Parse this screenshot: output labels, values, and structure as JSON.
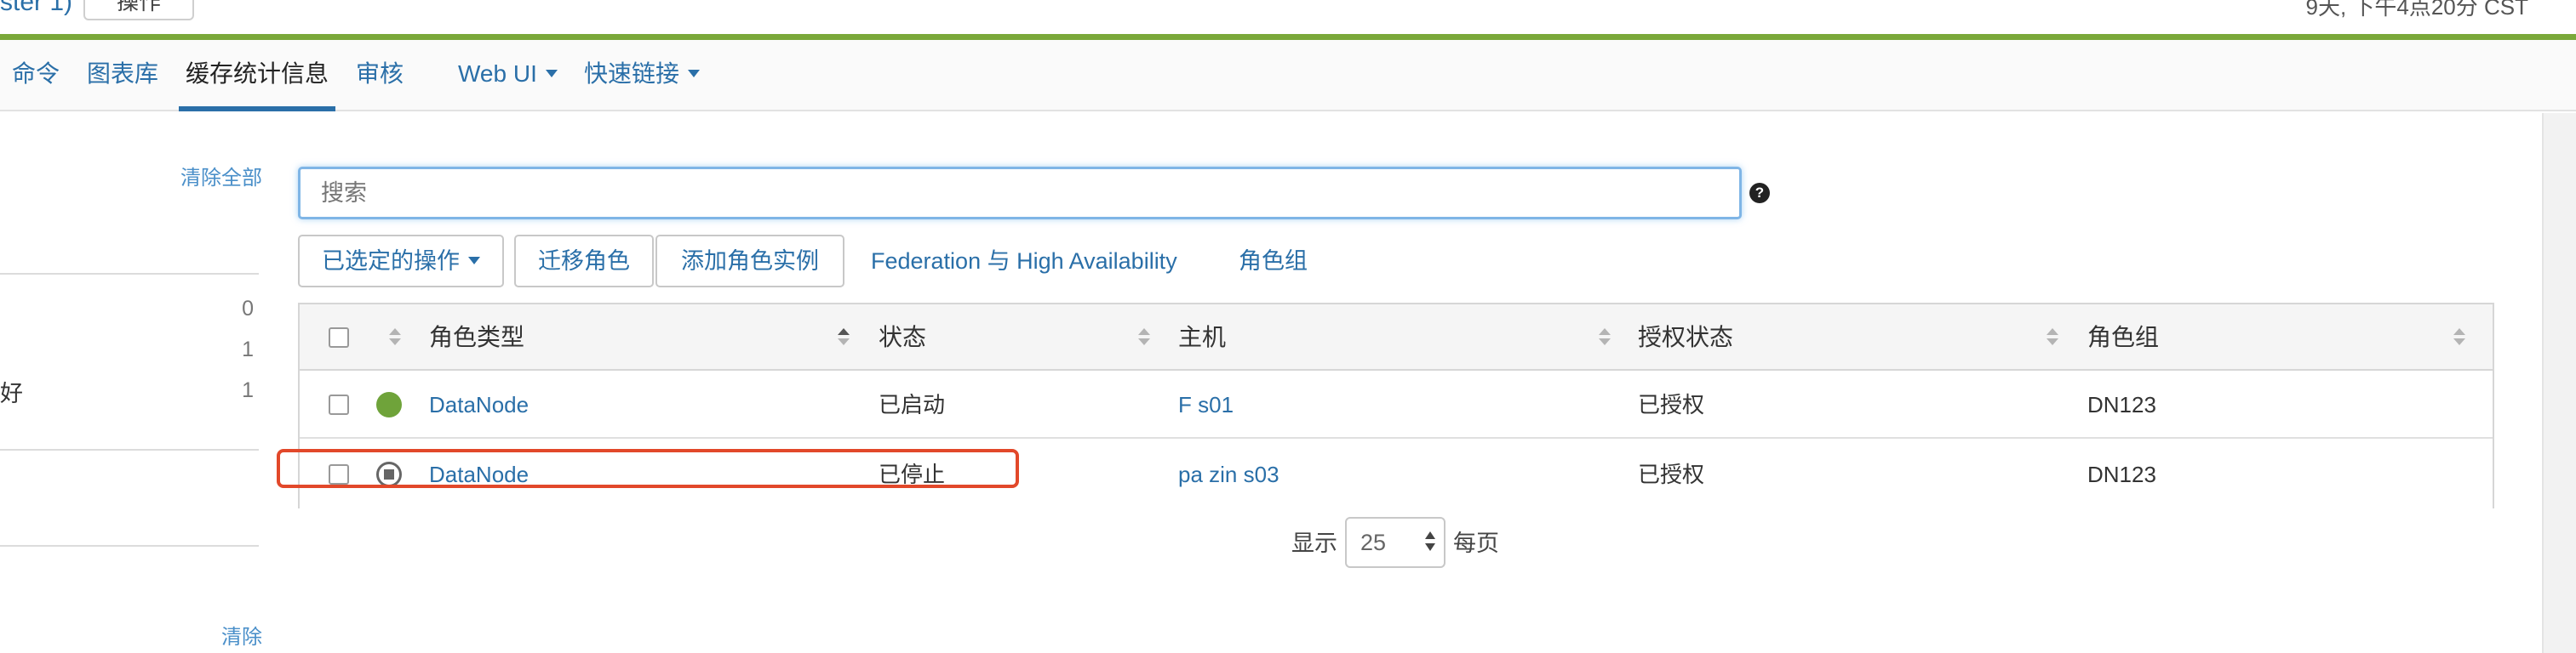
{
  "header": {
    "cluster_fragment": "ster 1)",
    "operations_button": "操作",
    "time_fragment": "9天, 下午4点20分 CST"
  },
  "nav": {
    "tabs": [
      {
        "label": "命令"
      },
      {
        "label": "图表库"
      },
      {
        "label": "缓存统计信息"
      },
      {
        "label": "审核"
      },
      {
        "label": "Web UI"
      },
      {
        "label": "快速链接"
      }
    ]
  },
  "filters": {
    "clear_all": "清除全部",
    "clear": "清除",
    "counts": [
      "0",
      "1",
      "1"
    ],
    "item_fragment": "好"
  },
  "search": {
    "placeholder": "搜索",
    "help_icon": "?"
  },
  "toolbar": {
    "selected_actions": "已选定的操作",
    "migrate_role": "迁移角色",
    "add_role_instances": "添加角色实例",
    "federation_ha": "Federation 与 High Availability",
    "role_groups": "角色组"
  },
  "table": {
    "columns": [
      "角色类型",
      "状态",
      "主机",
      "授权状态",
      "角色组"
    ],
    "rows": [
      {
        "role_type": "DataNode",
        "status": "已启动",
        "host": "F     s01",
        "commission": "已授权",
        "role_group": "DN123",
        "status_icon": "started-circle-icon"
      },
      {
        "role_type": "DataNode",
        "status": "已停止",
        "host": "pa zin     s03",
        "commission": "已授权",
        "role_group": "DN123",
        "status_icon": "stopped-circle-icon"
      }
    ]
  },
  "pager": {
    "show_label": "显示",
    "page_size": "25",
    "per_page_label": "每页"
  },
  "colors": {
    "accent_green": "#7aa83a",
    "link_blue": "#2a6fa8",
    "highlight_red": "#e2482a",
    "status_green": "#6fa33a"
  }
}
